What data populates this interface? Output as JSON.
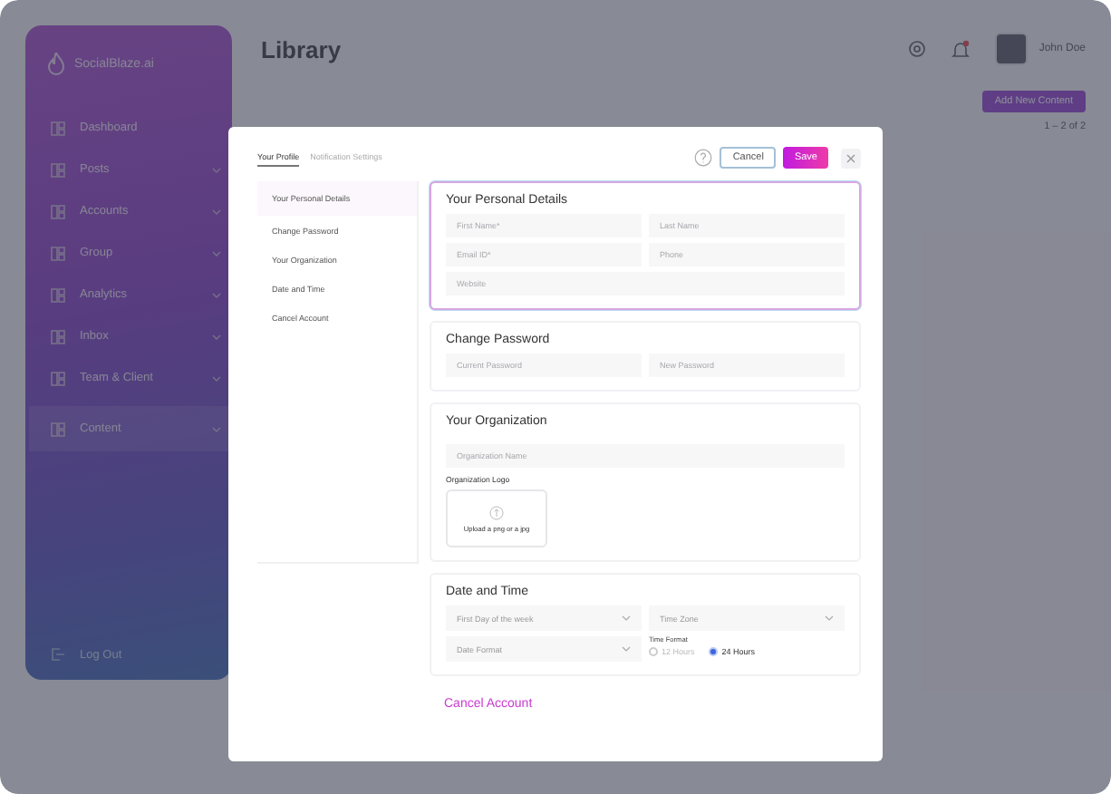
{
  "sidebar": {
    "logo": "SocialBlaze.ai",
    "items": [
      {
        "label": "Dashboard",
        "has_children": false,
        "selected": false
      },
      {
        "label": "Posts",
        "has_children": true,
        "selected": false
      },
      {
        "label": "Accounts",
        "has_children": true,
        "selected": false
      },
      {
        "label": "Group",
        "has_children": true,
        "selected": false
      },
      {
        "label": "Analytics",
        "has_children": true,
        "selected": false
      },
      {
        "label": "Inbox",
        "has_children": true,
        "selected": false
      },
      {
        "label": "Team & Client",
        "has_children": true,
        "selected": false
      },
      {
        "label": "Content",
        "has_children": true,
        "selected": true
      }
    ],
    "logout": "Log Out"
  },
  "header": {
    "title": "Library",
    "user": "John Doe",
    "notification": true
  },
  "toolbar": {
    "add_button": "Add New Content",
    "pagination": "1 – 2 of 2"
  },
  "modal": {
    "tabs": [
      {
        "label": "Your Profile",
        "selected": true
      },
      {
        "label": "Notification Settings",
        "selected": false
      }
    ],
    "cancel": "Cancel",
    "save": "Save",
    "nav": [
      {
        "label": "Your Personal Details",
        "selected": true
      },
      {
        "label": "Change Password",
        "selected": false
      },
      {
        "label": "Your Organization",
        "selected": false
      },
      {
        "label": "Date and Time",
        "selected": false
      },
      {
        "label": "Cancel Account",
        "selected": false
      }
    ],
    "personal": {
      "title": "Your Personal Details",
      "fields": [
        {
          "placeholder": "First Name*"
        },
        {
          "placeholder": "Last Name"
        },
        {
          "placeholder": "Email ID*"
        },
        {
          "placeholder": "Phone"
        },
        {
          "placeholder": "Website"
        }
      ]
    },
    "password": {
      "title": "Change Password",
      "fields": [
        {
          "placeholder": "Current Password"
        },
        {
          "placeholder": "New Password"
        }
      ]
    },
    "organization": {
      "title": "Your Organization",
      "name_placeholder": "Organization Name",
      "logo_label": "Organization Logo",
      "upload_text": "Upload a png or a jpg"
    },
    "date_time": {
      "title": "Date and Time",
      "selects": [
        {
          "placeholder": "First Day of the week"
        },
        {
          "placeholder": "Time Zone"
        },
        {
          "placeholder": "Date Format"
        }
      ],
      "time_format_label": "Time Format",
      "options": [
        {
          "label": "12 Hours",
          "selected": false
        },
        {
          "label": "24 Hours",
          "selected": true
        }
      ]
    },
    "cancel_account": "Cancel Account"
  }
}
